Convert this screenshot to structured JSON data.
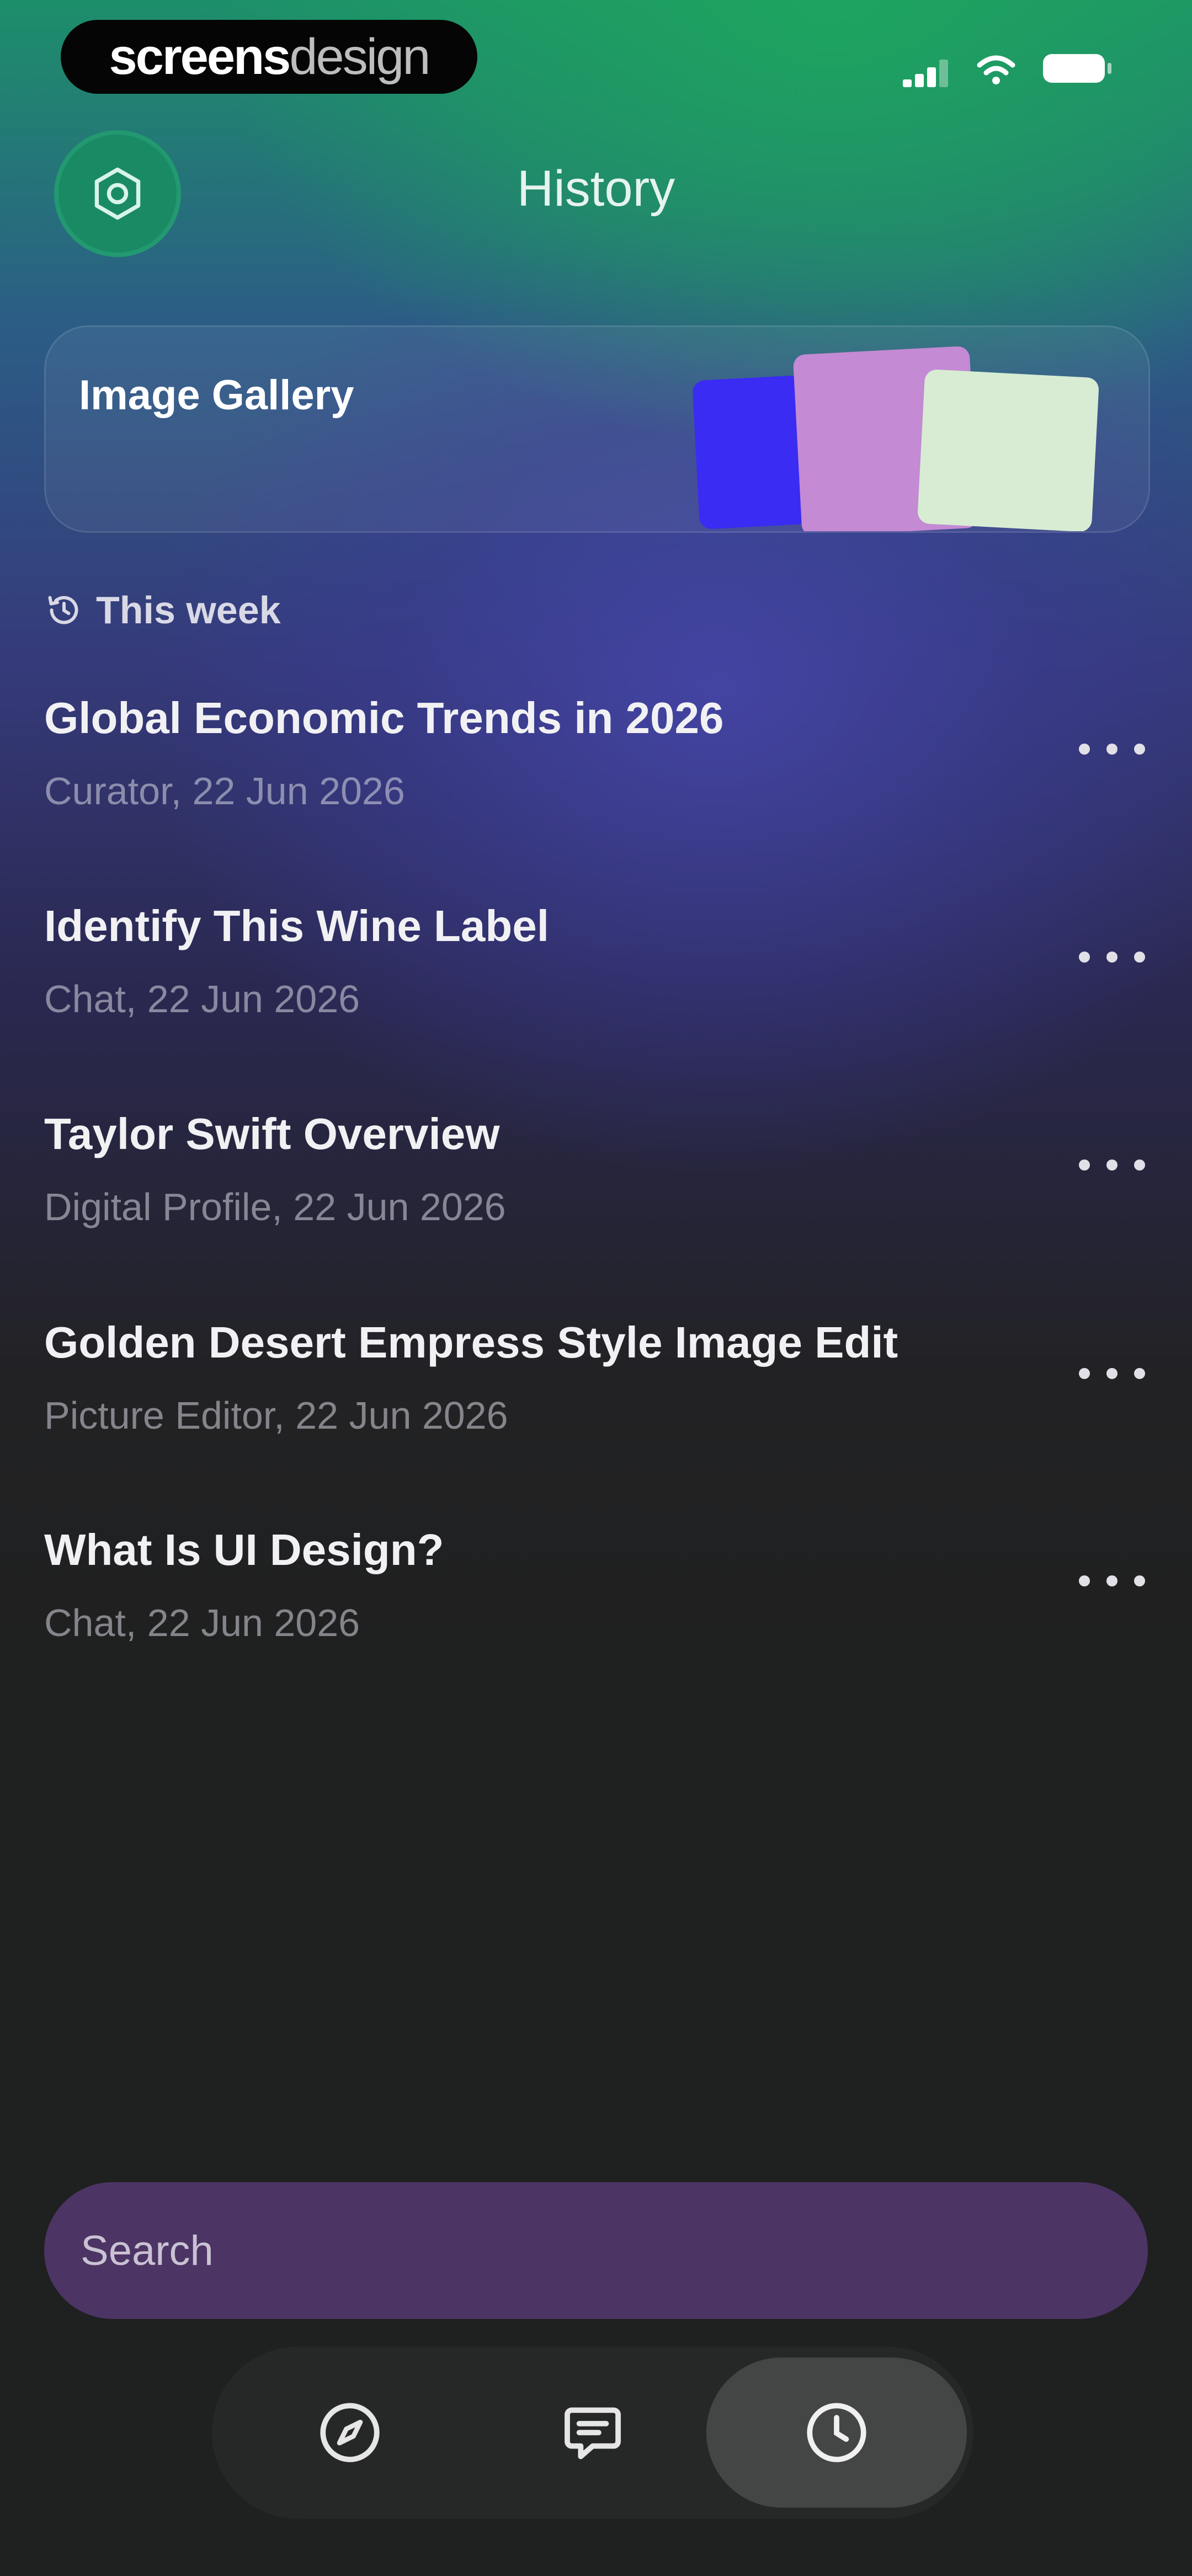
{
  "status_bar": {
    "brand": {
      "part1": "screens",
      "part2": "design"
    }
  },
  "header": {
    "title": "History",
    "settings_icon": "gear-icon"
  },
  "gallery": {
    "label": "Image Gallery",
    "thumb_colors": [
      "#3a2cf2",
      "#c48ad3",
      "#d7ecd3"
    ]
  },
  "section": {
    "label": "This week",
    "icon": "history-icon"
  },
  "items": [
    {
      "title": "Global Economic Trends in 2026",
      "subtitle": "Curator, 22 Jun 2026"
    },
    {
      "title": "Identify This Wine Label",
      "subtitle": "Chat, 22 Jun 2026"
    },
    {
      "title": "Taylor Swift Overview",
      "subtitle": "Digital Profile, 22 Jun 2026"
    },
    {
      "title": "Golden Desert Empress Style Image Edit",
      "subtitle": "Picture Editor, 22 Jun 2026"
    },
    {
      "title": "What Is UI Design?",
      "subtitle": "Chat, 22 Jun 2026"
    }
  ],
  "search": {
    "placeholder": "Search"
  },
  "nav": {
    "items": [
      {
        "icon": "compass-icon",
        "active": false
      },
      {
        "icon": "chat-icon",
        "active": false
      },
      {
        "icon": "clock-icon",
        "active": true
      }
    ]
  },
  "colors": {
    "accent_green": "#1a8a64",
    "search_bg": "#4c3464",
    "background": "#1f2020"
  }
}
